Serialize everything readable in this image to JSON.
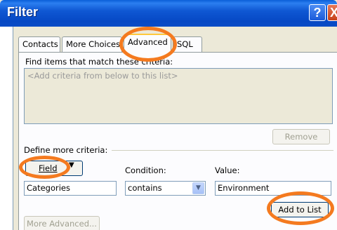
{
  "window": {
    "title": "Filter",
    "help_glyph": "?",
    "close_glyph": "X"
  },
  "tabs": [
    {
      "label": "Contacts",
      "active": false
    },
    {
      "label": "More Choices",
      "active": false
    },
    {
      "label": "Advanced",
      "active": true
    },
    {
      "label": "SQL",
      "active": false
    }
  ],
  "criteria": {
    "find_label": "Find items that match these criteria:",
    "placeholder": "<Add criteria from below to this list>",
    "remove_label": "Remove"
  },
  "define": {
    "label": "Define more criteria:",
    "field_button_label": "Field",
    "condition_label": "Condition:",
    "value_label": "Value:",
    "field_value": "Categories",
    "condition_value": "contains",
    "value_value": "Environment",
    "add_to_list_label": "Add to List",
    "more_advanced_label": "More Advanced..."
  },
  "annotations": {
    "highlight_color": "#f47a1f"
  },
  "colors": {
    "titlebar": "#0a4cc6",
    "dialog_bg": "#ece9d8",
    "panel_bg": "#fcfcfe"
  }
}
